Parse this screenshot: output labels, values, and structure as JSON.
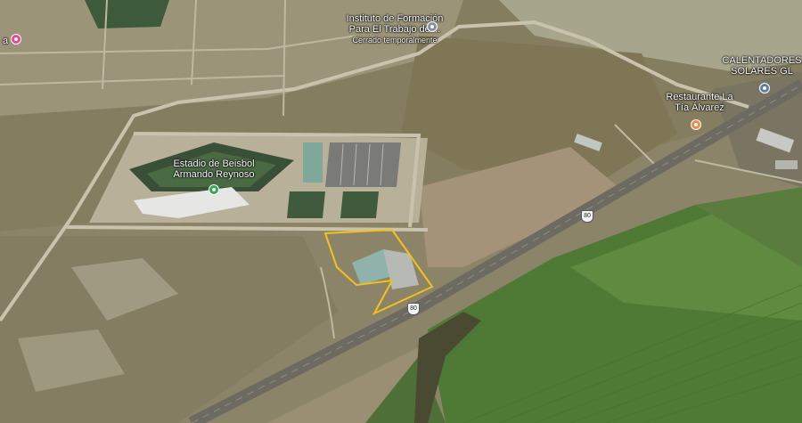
{
  "places": {
    "instituto": {
      "name": "Instituto de Formación",
      "name2": "Para El Trabajo del...",
      "status": "Cerrado temporalmente"
    },
    "calentadores": {
      "name": "CALENTADORES",
      "name2": "SOLARES GL"
    },
    "restaurante": {
      "name": "Restaurante La",
      "name2": "Tía Álvarez"
    },
    "estadio": {
      "name": "Estadio de Beisbol",
      "name2": "Armando Reynoso"
    },
    "left_edge": {
      "name": "a"
    }
  },
  "road_shields": [
    "80",
    "80"
  ],
  "colors": {
    "parcel_outline": "#f2c21b",
    "stadium_pin": "#34a853",
    "restaurant_pin": "#f28b4a",
    "service_pin": "#5f7da6",
    "education_pin": "#8a8fa0",
    "shop_pin": "#e84a8c",
    "highway": "#6d6a62",
    "field_green": "#4f7a35"
  },
  "icons": [
    "map-pin-icon",
    "highway-shield-icon"
  ]
}
